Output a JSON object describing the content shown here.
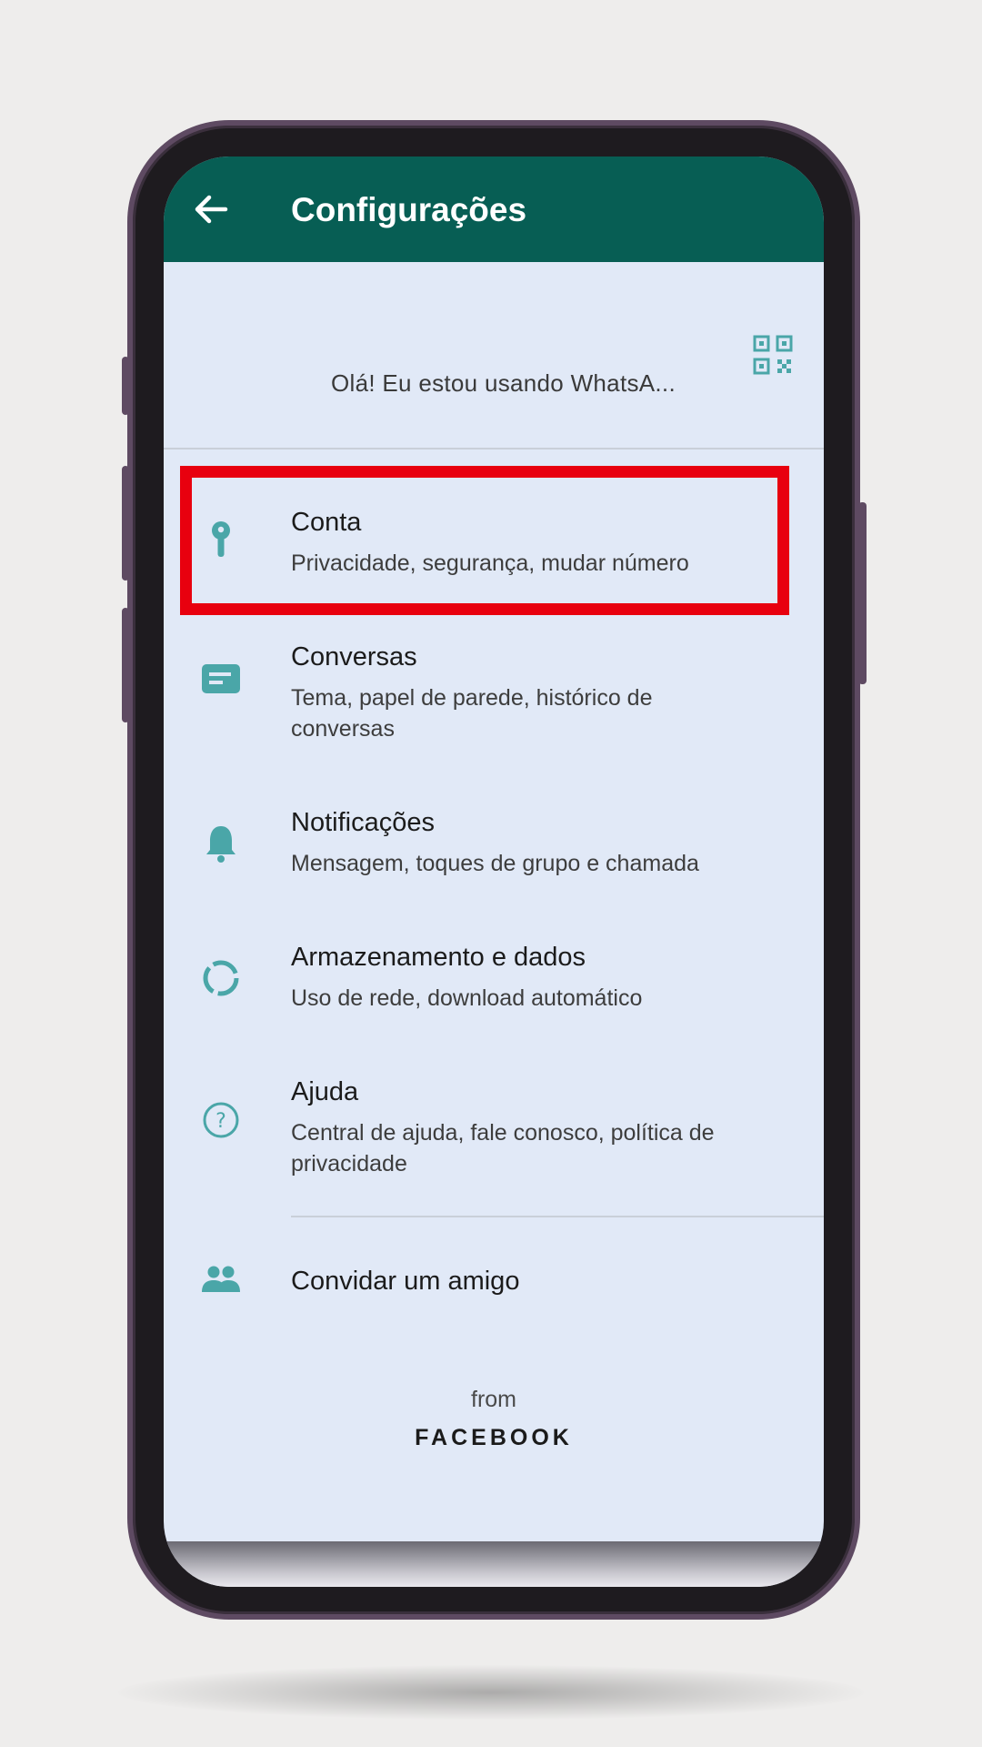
{
  "colors": {
    "appbar": "#075e54",
    "accent_icon": "#4aa6a8",
    "highlight_border": "#e8000f",
    "screen_bg": "#e1e9f7"
  },
  "header": {
    "title": "Configurações",
    "back_icon": "arrow-left-icon"
  },
  "profile": {
    "status": "Olá! Eu estou usando WhatsA...",
    "qr_icon": "qr-code-icon"
  },
  "settings": [
    {
      "icon": "key-icon",
      "title": "Conta",
      "subtitle": "Privacidade, segurança, mudar número"
    },
    {
      "icon": "chat-icon",
      "title": "Conversas",
      "subtitle": "Tema, papel de parede, histórico de conversas"
    },
    {
      "icon": "bell-icon",
      "title": "Notificações",
      "subtitle": "Mensagem, toques de grupo e chamada"
    },
    {
      "icon": "data-usage-icon",
      "title": "Armazenamento e dados",
      "subtitle": "Uso de rede, download automático"
    },
    {
      "icon": "help-icon",
      "title": "Ajuda",
      "subtitle": "Central de ajuda, fale conosco, política de privacidade"
    }
  ],
  "invite": {
    "icon": "people-icon",
    "label": "Convidar um amigo"
  },
  "footer": {
    "from": "from",
    "brand": "FACEBOOK"
  }
}
